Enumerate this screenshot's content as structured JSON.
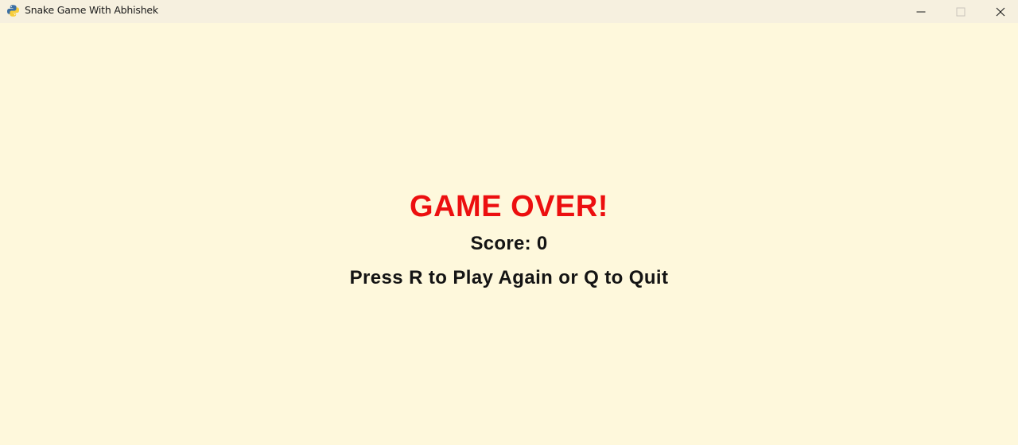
{
  "window": {
    "title": "Snake Game With Abhishek",
    "app_icon": "python-icon",
    "controls": [
      "minimize-icon",
      "maximize-icon",
      "close-icon"
    ]
  },
  "game": {
    "background_color": "#fef8dc",
    "headline": "GAME OVER!",
    "headline_color": "#ec0f0f",
    "score_text": "Score: 0",
    "score": 0,
    "prompt": "Press R to Play Again or Q to Quit",
    "text_color": "#141414"
  }
}
